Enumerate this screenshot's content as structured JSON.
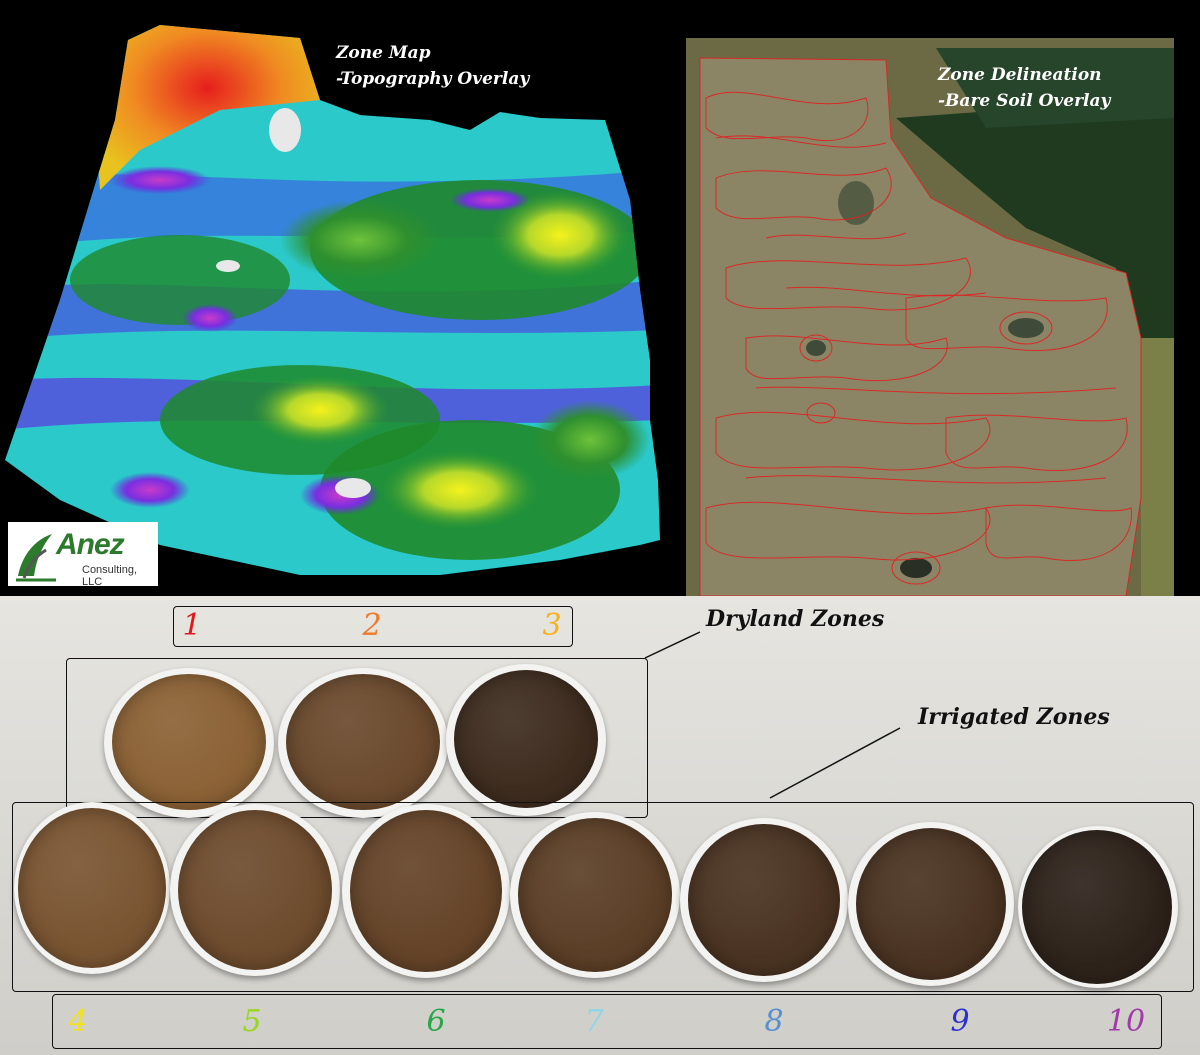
{
  "topo_panel": {
    "title_line1": "Zone Map",
    "title_line2": "-Topography Overlay"
  },
  "aerial_panel": {
    "title_line1": "Zone Delineation",
    "title_line2": "-Bare Soil Overlay"
  },
  "logo": {
    "name": "Anez",
    "sub": "Consulting, LLC",
    "brand_color": "#2c7a2c"
  },
  "dryland": {
    "title": "Dryland Zones",
    "zones": [
      {
        "label": "1",
        "color": "#e01818"
      },
      {
        "label": "2",
        "color": "#f07a2a"
      },
      {
        "label": "3",
        "color": "#f5b21d"
      }
    ]
  },
  "irrigated": {
    "title": "Irrigated Zones",
    "zones": [
      {
        "label": "4",
        "color": "#f2e21a"
      },
      {
        "label": "5",
        "color": "#9ad61e"
      },
      {
        "label": "6",
        "color": "#27a847"
      },
      {
        "label": "7",
        "color": "#8fd6e6"
      },
      {
        "label": "8",
        "color": "#5a8fcf"
      },
      {
        "label": "9",
        "color": "#2b2fcf"
      },
      {
        "label": "10",
        "color": "#a13aa8"
      }
    ]
  },
  "soil_colors": [
    "#8c6236",
    "#6b4a2e",
    "#3e2c1f",
    "#7a5532",
    "#6e4c2e",
    "#654429",
    "#5c3f27",
    "#4a3322",
    "#4a3322",
    "#2e231b"
  ]
}
